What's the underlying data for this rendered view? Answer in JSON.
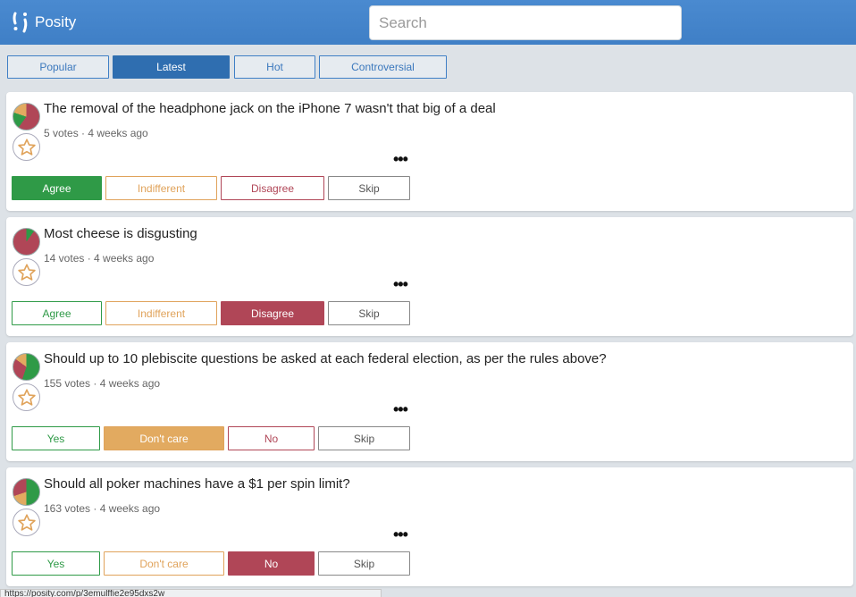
{
  "app": {
    "name": "Posity"
  },
  "search": {
    "placeholder": "Search"
  },
  "tabs": [
    {
      "label": "Popular",
      "active": false
    },
    {
      "label": "Latest",
      "active": true
    },
    {
      "label": "Hot",
      "active": false
    },
    {
      "label": "Controversial",
      "active": false
    }
  ],
  "colors": {
    "agree": "#2f9a47",
    "indifferent": "#e0a35b",
    "disagree": "#b04657",
    "header": "#4a8ad0"
  },
  "questions": [
    {
      "title": "The removal of the headphone jack on the iPhone 7 wasn't that big of a deal",
      "meta": "5 votes · 4 weeks ago",
      "more": "•••",
      "buttons": {
        "yes": "Agree",
        "mid": "Indifferent",
        "no": "Disagree",
        "skip": "Skip"
      },
      "selected": "yes"
    },
    {
      "title": "Most cheese is disgusting",
      "meta": "14 votes · 4 weeks ago",
      "more": "•••",
      "buttons": {
        "yes": "Agree",
        "mid": "Indifferent",
        "no": "Disagree",
        "skip": "Skip"
      },
      "selected": "no"
    },
    {
      "title": "Should up to 10 plebiscite questions be asked at each federal election, as per the rules above?",
      "meta": "155 votes · 4 weeks ago",
      "more": "•••",
      "buttons": {
        "yes": "Yes",
        "mid": "Don't care",
        "no": "No",
        "skip": "Skip"
      },
      "selected": "mid"
    },
    {
      "title": "Should all poker machines have a $1 per spin limit?",
      "meta": "163 votes · 4 weeks ago",
      "more": "•••",
      "buttons": {
        "yes": "Yes",
        "mid": "Don't care",
        "no": "No",
        "skip": "Skip"
      },
      "selected": "no"
    }
  ],
  "status_url": "https://posity.com/p/3emulffie2e95dxs2w"
}
